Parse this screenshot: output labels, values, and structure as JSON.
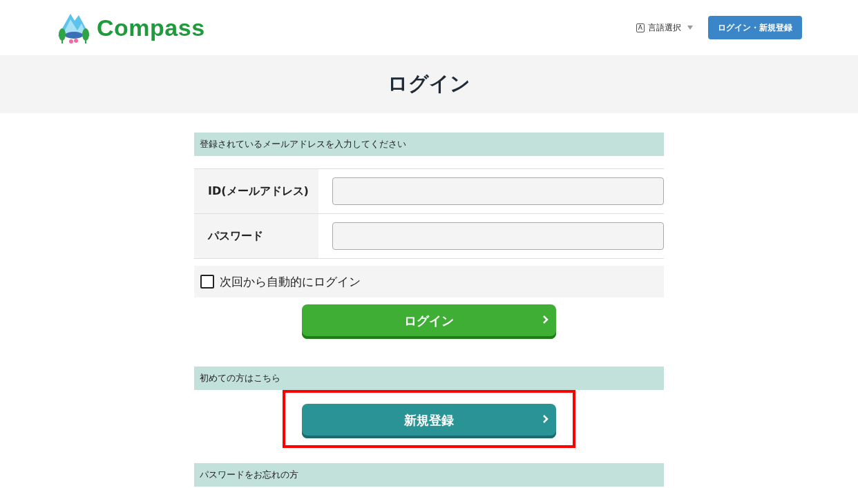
{
  "header": {
    "logo": "Compass",
    "language": {
      "label": "言語選択",
      "badge": "A"
    },
    "auth_button": "ログイン・新規登録"
  },
  "page_title": "ログイン",
  "login": {
    "section_title": "登録されているメールアドレスを入力してください",
    "fields": [
      {
        "label": "ID(メールアドレス)"
      },
      {
        "label": "パスワード"
      }
    ],
    "remember": {
      "label": "次回から自動的にログイン",
      "checked": false
    },
    "submit": "ログイン"
  },
  "register": {
    "section_title": "初めての方はこちら",
    "button": "新規登録",
    "highlighted": true
  },
  "forgot": {
    "section_title": "パスワードをお忘れの方"
  }
}
